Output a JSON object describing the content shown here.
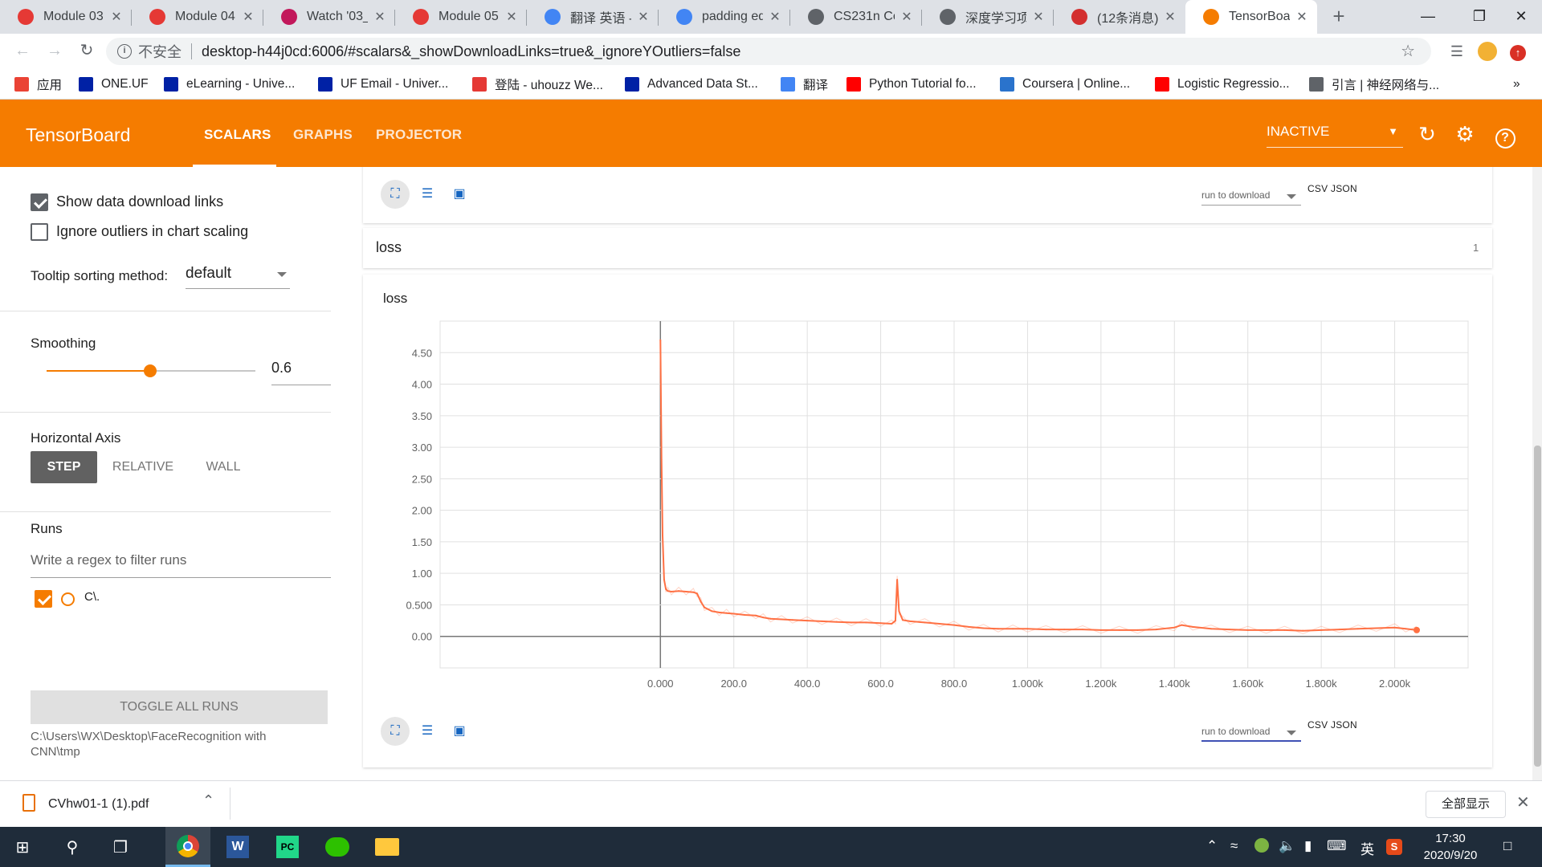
{
  "browser": {
    "tabs": [
      {
        "label": "Module 03:",
        "favicon_color": "#e53935",
        "active": false
      },
      {
        "label": "Module 04:",
        "favicon_color": "#e53935",
        "active": false
      },
      {
        "label": "Watch '03_I",
        "favicon_color": "#c2185b",
        "active": false
      },
      {
        "label": "Module 05:",
        "favicon_color": "#e53935",
        "active": false
      },
      {
        "label": "翻译 英语 -",
        "favicon_color": "#4285f4",
        "active": false
      },
      {
        "label": "padding eq",
        "favicon_color": "#4285f4",
        "active": false
      },
      {
        "label": "CS231n Co",
        "favicon_color": "#5f6368",
        "active": false
      },
      {
        "label": "深度学习项E",
        "favicon_color": "#5f6368",
        "active": false
      },
      {
        "label": "(12条消息)",
        "favicon_color": "#d32f2f",
        "active": false
      },
      {
        "label": "TensorBoar",
        "favicon_color": "#f57c00",
        "active": true
      }
    ],
    "omnibox": {
      "security_label": "不安全",
      "url": "desktop-h44j0cd:6006/#scalars&_showDownloadLinks=true&_ignoreYOutliers=false"
    },
    "bookmarks": [
      {
        "label": "应用",
        "icon": "apps-grid-icon"
      },
      {
        "label": "ONE.UF",
        "icon": "uf-icon"
      },
      {
        "label": "eLearning - Unive...",
        "icon": "uf-icon"
      },
      {
        "label": "UF Email - Univer...",
        "icon": "uf-icon"
      },
      {
        "label": "登陆 - uhouzz We...",
        "icon": "mail-icon"
      },
      {
        "label": "Advanced Data St...",
        "icon": "uf-icon"
      },
      {
        "label": "翻译",
        "icon": "translate-icon"
      },
      {
        "label": "Python Tutorial fo...",
        "icon": "youtube-icon"
      },
      {
        "label": "Coursera | Online...",
        "icon": "coursera-icon"
      },
      {
        "label": "Logistic Regressio...",
        "icon": "youtube-icon"
      },
      {
        "label": "引言 | 神经网络与...",
        "icon": "book-icon"
      }
    ],
    "bookmarks_overflow": "»"
  },
  "tensorboard": {
    "title": "TensorBoard",
    "nav": [
      "SCALARS",
      "GRAPHS",
      "PROJECTOR"
    ],
    "active_nav": "SCALARS",
    "status": "INACTIVE"
  },
  "sidebar": {
    "show_download_links": {
      "label": "Show data download links",
      "checked": true
    },
    "ignore_outliers": {
      "label": "Ignore outliers in chart scaling",
      "checked": false
    },
    "tooltip_label": "Tooltip sorting method:",
    "tooltip_value": "default",
    "smoothing_label": "Smoothing",
    "smoothing_value": "0.6",
    "smoothing_fraction": 0.6,
    "horizontal_axis_label": "Horizontal Axis",
    "axis_options": [
      "STEP",
      "RELATIVE",
      "WALL"
    ],
    "axis_selected": "STEP",
    "runs_label": "Runs",
    "runs_filter_placeholder": "Write a regex to filter runs",
    "run_name": "C\\.",
    "toggle_all": "TOGGLE ALL RUNS",
    "logdir": "C:\\Users\\WX\\Desktop\\FaceRecognition with CNN\\tmp"
  },
  "main": {
    "prev_card": {
      "run_to_download": "run to download",
      "csv": "CSV",
      "json": "JSON"
    },
    "group": {
      "title": "loss",
      "count": "1"
    },
    "chart_card": {
      "title": "loss",
      "run_to_download": "run to download",
      "csv": "CSV",
      "json": "JSON"
    }
  },
  "chart_data": {
    "type": "line",
    "title": "loss",
    "xlabel": "",
    "ylabel": "",
    "xlim": [
      -600,
      2200
    ],
    "ylim": [
      -0.5,
      5.0
    ],
    "x_ticks": [
      0,
      200,
      400,
      600,
      800,
      1000,
      1200,
      1400,
      1600,
      1800,
      2000
    ],
    "x_tick_labels": [
      "0.000",
      "200.0",
      "400.0",
      "600.0",
      "800.0",
      "1.000k",
      "1.200k",
      "1.400k",
      "1.600k",
      "1.800k",
      "2.000k"
    ],
    "y_ticks": [
      0,
      0.5,
      1.0,
      1.5,
      2.0,
      2.5,
      3.0,
      3.5,
      4.0,
      4.5
    ],
    "y_tick_labels": [
      "0.00",
      "0.500",
      "1.00",
      "1.50",
      "2.00",
      "2.50",
      "3.00",
      "3.50",
      "4.00",
      "4.50"
    ],
    "grid": true,
    "color": "#ff7043",
    "series": [
      {
        "x": [
          0,
          3,
          6,
          10,
          15,
          20,
          30,
          50,
          70,
          90,
          100,
          110,
          120,
          140,
          160,
          180,
          200,
          230,
          260,
          280,
          300,
          330,
          360,
          400,
          440,
          480,
          520,
          560,
          600,
          630,
          640,
          645,
          650,
          660,
          680,
          720,
          760,
          800,
          840,
          880,
          920,
          960,
          1000,
          1050,
          1100,
          1150,
          1200,
          1250,
          1300,
          1350,
          1400,
          1420,
          1450,
          1500,
          1550,
          1600,
          1650,
          1700,
          1750,
          1800,
          1850,
          1900,
          1950,
          2000,
          2030,
          2060
        ],
        "y": [
          4.7,
          2.8,
          1.6,
          0.9,
          0.75,
          0.72,
          0.71,
          0.72,
          0.71,
          0.7,
          0.68,
          0.55,
          0.46,
          0.4,
          0.38,
          0.37,
          0.36,
          0.34,
          0.33,
          0.3,
          0.28,
          0.27,
          0.26,
          0.25,
          0.24,
          0.23,
          0.22,
          0.22,
          0.21,
          0.2,
          0.25,
          0.9,
          0.4,
          0.26,
          0.24,
          0.22,
          0.2,
          0.18,
          0.15,
          0.13,
          0.12,
          0.12,
          0.12,
          0.11,
          0.11,
          0.11,
          0.1,
          0.1,
          0.1,
          0.11,
          0.14,
          0.18,
          0.15,
          0.12,
          0.11,
          0.1,
          0.1,
          0.1,
          0.09,
          0.1,
          0.11,
          0.12,
          0.13,
          0.14,
          0.12,
          0.1
        ]
      }
    ]
  }
}
